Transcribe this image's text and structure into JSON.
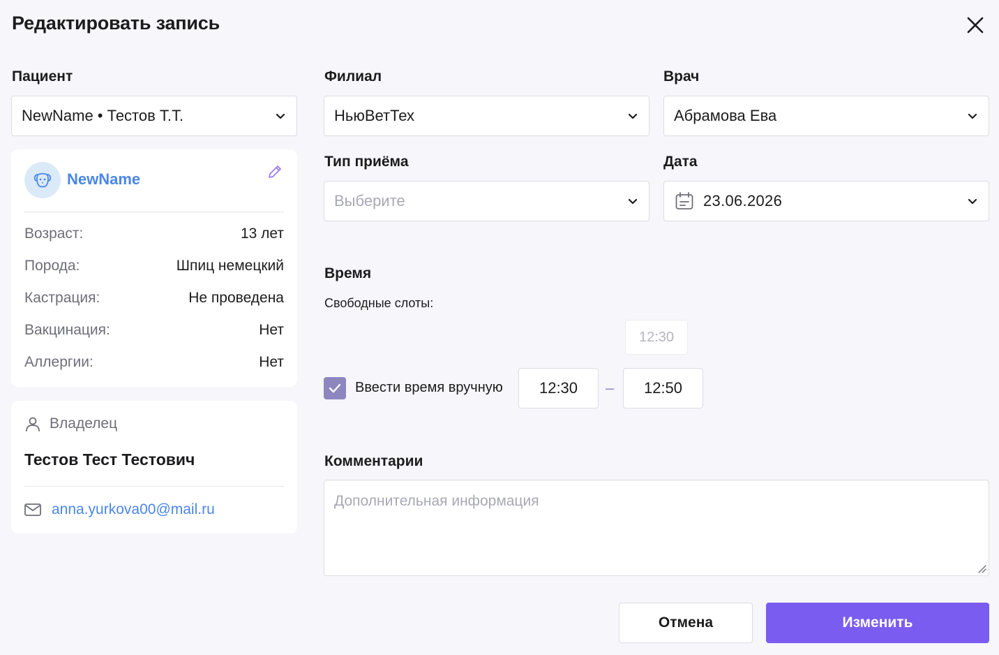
{
  "modal": {
    "title": "Редактировать запись"
  },
  "patient": {
    "label": "Пациент",
    "selected": "NewName • Тестов Т.Т.",
    "card": {
      "name": "NewName",
      "rows": [
        {
          "label": "Возраст:",
          "value": "13 лет"
        },
        {
          "label": "Порода:",
          "value": "Шпиц немецкий"
        },
        {
          "label": "Кастрация:",
          "value": "Не проведена"
        },
        {
          "label": "Вакцинация:",
          "value": "Нет"
        },
        {
          "label": "Аллергии:",
          "value": "Нет"
        }
      ]
    }
  },
  "owner": {
    "heading": "Владелец",
    "name": "Тестов Тест Тестович",
    "email": "anna.yurkova00@mail.ru"
  },
  "branch": {
    "label": "Филиал",
    "selected": "НьюВетТех"
  },
  "doctor": {
    "label": "Врач",
    "selected": "Абрамова Ева"
  },
  "appointment_type": {
    "label": "Тип приёма",
    "placeholder": "Выберите"
  },
  "date": {
    "label": "Дата",
    "value": "23.06.2026"
  },
  "time": {
    "heading": "Время",
    "free_slots_label": "Свободные слоты:",
    "slots": [
      "12:30"
    ],
    "manual_label": "Ввести время вручную",
    "manual_checked": true,
    "from": "12:30",
    "separator": "–",
    "to": "12:50"
  },
  "comments": {
    "label": "Комментарии",
    "placeholder": "Дополнительная информация"
  },
  "actions": {
    "cancel": "Отмена",
    "submit": "Изменить"
  },
  "colors": {
    "accent": "#7b5cf0",
    "link": "#4a86e8",
    "checkbox": "#8e86bf"
  }
}
